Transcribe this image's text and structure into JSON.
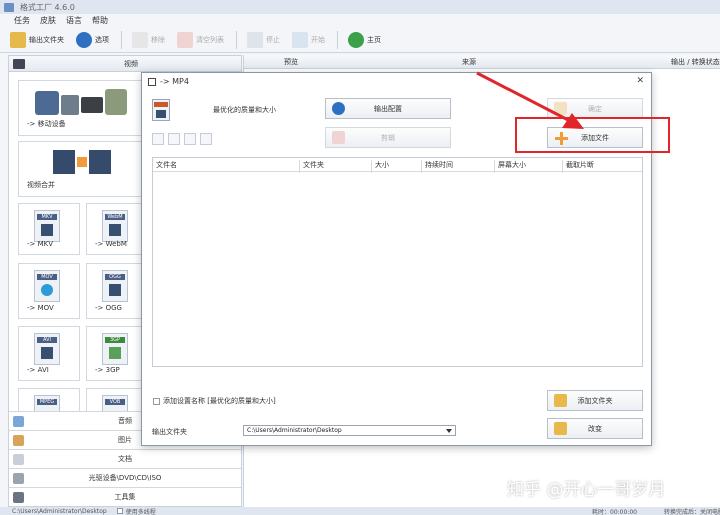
{
  "window": {
    "title": "格式工厂 4.6.0"
  },
  "menu": [
    "任务",
    "皮肤",
    "语言",
    "帮助"
  ],
  "toolbar": {
    "output_folder": "输出文件夹",
    "options": "选项",
    "remove": "移除",
    "clear_list": "清空列表",
    "stop": "停止",
    "start": "开始",
    "home": "主页"
  },
  "left_panel": {
    "video_header": "视频",
    "tiles": [
      {
        "label": "-> 移动设备"
      },
      {
        "label": "视频合并"
      },
      {
        "label": "-> MKV",
        "badge": "MKV"
      },
      {
        "label": "-> WebM",
        "badge": "WebM"
      },
      {
        "label": "-> MOV",
        "badge": "MOV"
      },
      {
        "label": "-> OGG",
        "badge": "OGG"
      },
      {
        "label": "-> AVI",
        "badge": "AVI"
      },
      {
        "label": "-> 3GP",
        "badge": "3GP"
      },
      {
        "badge": "MPEG"
      },
      {
        "badge": "VOB"
      }
    ],
    "categories": [
      "音频",
      "图片",
      "文档",
      "光驱设备\\DVD\\CD\\ISO",
      "工具集"
    ]
  },
  "right_panel": {
    "columns": [
      "预览",
      "来源",
      "输出 / 转换状态"
    ]
  },
  "dialog": {
    "title": "-> MP4",
    "preset": "最优化的质量和大小",
    "output_config": "输出配置",
    "ok": "确定",
    "clip": "剪辑",
    "add_file": "添加文件",
    "columns": [
      "文件名",
      "文件夹",
      "大小",
      "持续时间",
      "屏幕大小",
      "截取片断"
    ],
    "add_setting_name": "添加设置名称 [最优化的质量和大小]",
    "add_folder": "添加文件夹",
    "output_folder_label": "输出文件夹",
    "output_folder_value": "C:\\Users\\Administrator\\Desktop",
    "change": "改变"
  },
  "statusbar": {
    "path": "C:\\Users\\Administrator\\Desktop",
    "multithread": "使用多线程",
    "elapsed": "耗时：00:00:00",
    "after_convert": "转换完成后：关闭电脑"
  },
  "watermark": "知乎 @开心一哥岁月",
  "colors": {
    "annotation_red": "#e0262b",
    "add_icon_orange": "#f29b3a"
  }
}
